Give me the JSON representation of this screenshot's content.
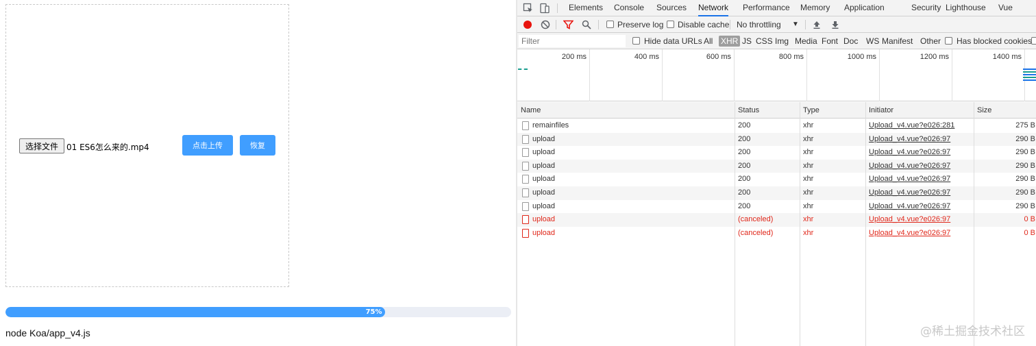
{
  "app": {
    "file_button": "选择文件",
    "file_name": "01 ES6怎么来的.mp4",
    "upload_button": "点击上传",
    "restore_button": "恢复",
    "progress_value": 75,
    "progress_label": "75%",
    "command_text": "node Koa/app_v4.js"
  },
  "devtools": {
    "tabs": [
      "Elements",
      "Console",
      "Sources",
      "Network",
      "Performance",
      "Memory",
      "Application",
      "Security",
      "Lighthouse",
      "Vue"
    ],
    "active_tab": "Network",
    "toolbar": {
      "preserve_log": "Preserve log",
      "disable_cache": "Disable cache",
      "throttling": "No throttling"
    },
    "filter": {
      "placeholder": "Filter",
      "hide_data_urls": "Hide data URLs",
      "types": [
        "All",
        "XHR",
        "JS",
        "CSS",
        "Img",
        "Media",
        "Font",
        "Doc",
        "WS",
        "Manifest",
        "Other"
      ],
      "active_type": "XHR",
      "has_blocked_cookies": "Has blocked cookies"
    },
    "timeline_ticks": [
      "200 ms",
      "400 ms",
      "600 ms",
      "800 ms",
      "1000 ms",
      "1200 ms",
      "1400 ms"
    ],
    "columns": [
      "Name",
      "Status",
      "Type",
      "Initiator",
      "Size"
    ],
    "rows": [
      {
        "name": "remainfiles",
        "status": "200",
        "type": "xhr",
        "initiator": "Upload_v4.vue?e026:281",
        "size": "275 B",
        "error": false
      },
      {
        "name": "upload",
        "status": "200",
        "type": "xhr",
        "initiator": "Upload_v4.vue?e026:97",
        "size": "290 B",
        "error": false
      },
      {
        "name": "upload",
        "status": "200",
        "type": "xhr",
        "initiator": "Upload_v4.vue?e026:97",
        "size": "290 B",
        "error": false
      },
      {
        "name": "upload",
        "status": "200",
        "type": "xhr",
        "initiator": "Upload_v4.vue?e026:97",
        "size": "290 B",
        "error": false
      },
      {
        "name": "upload",
        "status": "200",
        "type": "xhr",
        "initiator": "Upload_v4.vue?e026:97",
        "size": "290 B",
        "error": false
      },
      {
        "name": "upload",
        "status": "200",
        "type": "xhr",
        "initiator": "Upload_v4.vue?e026:97",
        "size": "290 B",
        "error": false
      },
      {
        "name": "upload",
        "status": "200",
        "type": "xhr",
        "initiator": "Upload_v4.vue?e026:97",
        "size": "290 B",
        "error": false
      },
      {
        "name": "upload",
        "status": "(canceled)",
        "type": "xhr",
        "initiator": "Upload_v4.vue?e026:97",
        "size": "0 B",
        "error": true
      },
      {
        "name": "upload",
        "status": "(canceled)",
        "type": "xhr",
        "initiator": "Upload_v4.vue?e026:97",
        "size": "0 B",
        "error": true
      }
    ]
  },
  "watermark": "@稀土掘金技术社区",
  "colors": {
    "accent": "#409eff",
    "error": "#e0271a",
    "record": "#e8140e",
    "active_tab_underline": "#1a73e8"
  }
}
